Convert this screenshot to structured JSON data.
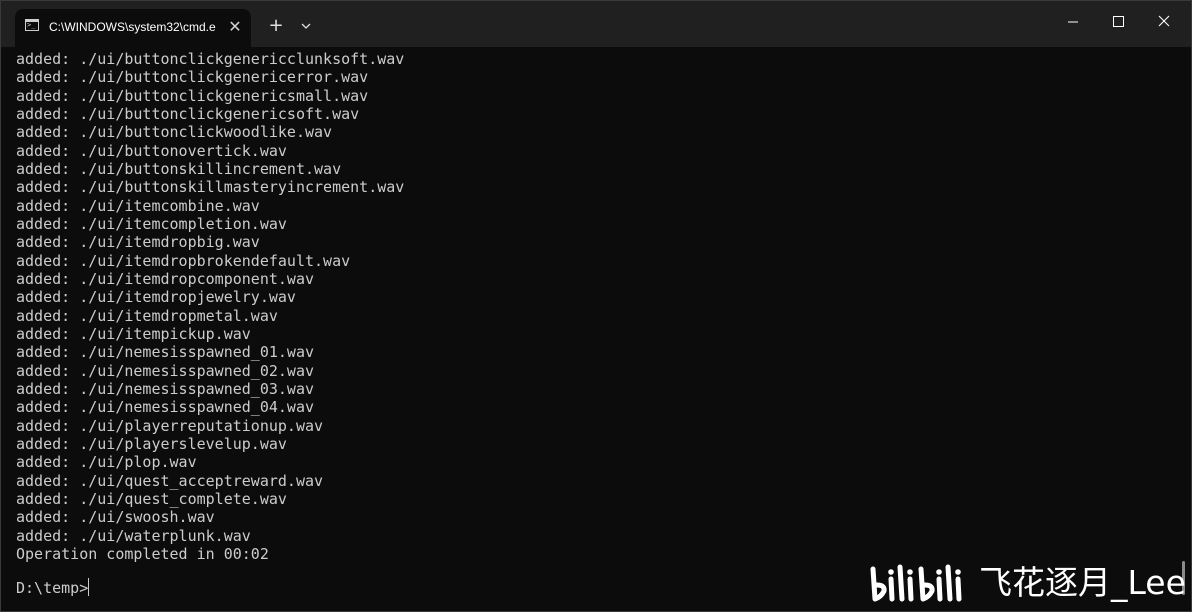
{
  "window": {
    "tab_title": "C:\\WINDOWS\\system32\\cmd.e",
    "tab_close_glyph": "✕",
    "new_tab_glyph": "+",
    "controls": [
      "minimize",
      "maximize",
      "close"
    ]
  },
  "console": {
    "lines": [
      "added: ./ui/buttonclickgenericclunksoft.wav",
      "added: ./ui/buttonclickgenericerror.wav",
      "added: ./ui/buttonclickgenericsmall.wav",
      "added: ./ui/buttonclickgenericsoft.wav",
      "added: ./ui/buttonclickwoodlike.wav",
      "added: ./ui/buttonovertick.wav",
      "added: ./ui/buttonskillincrement.wav",
      "added: ./ui/buttonskillmasteryincrement.wav",
      "added: ./ui/itemcombine.wav",
      "added: ./ui/itemcompletion.wav",
      "added: ./ui/itemdropbig.wav",
      "added: ./ui/itemdropbrokendefault.wav",
      "added: ./ui/itemdropcomponent.wav",
      "added: ./ui/itemdropjewelry.wav",
      "added: ./ui/itemdropmetal.wav",
      "added: ./ui/itempickup.wav",
      "added: ./ui/nemesisspawned_01.wav",
      "added: ./ui/nemesisspawned_02.wav",
      "added: ./ui/nemesisspawned_03.wav",
      "added: ./ui/nemesisspawned_04.wav",
      "added: ./ui/playerreputationup.wav",
      "added: ./ui/playerslevelup.wav",
      "added: ./ui/plop.wav",
      "added: ./ui/quest_acceptreward.wav",
      "added: ./ui/quest_complete.wav",
      "added: ./ui/swoosh.wav",
      "added: ./ui/waterplunk.wav",
      "Operation completed in 00:02"
    ],
    "prompt": "D:\\temp>"
  },
  "watermark": {
    "logo": "bilibili",
    "text": "飞花逐月_Lee"
  },
  "colors": {
    "console_bg": "#0c0c0c",
    "console_text": "#cccccc",
    "titlebar_bg": "#202020"
  }
}
